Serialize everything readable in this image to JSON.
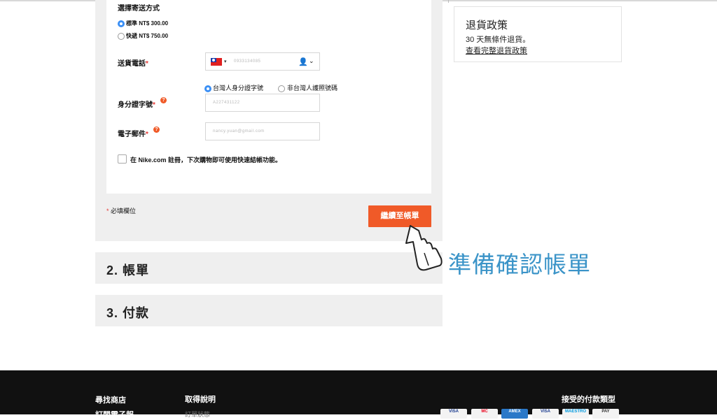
{
  "shipping": {
    "method_label": "選擇寄送方式",
    "options": [
      {
        "label": "標準 NT$ 300.00",
        "selected": true
      },
      {
        "label": "快遞 NT$ 750.00",
        "selected": false
      }
    ],
    "phone": {
      "label": "送貨電話",
      "required_mark": "*",
      "value": "0933134085"
    },
    "id_type": {
      "options": [
        {
          "label": "台灣人身分證字號",
          "selected": true
        },
        {
          "label": "非台灣人護照號碼",
          "selected": false
        }
      ]
    },
    "id_number": {
      "label": "身分證字號",
      "required_mark": "*",
      "value": "A227431122"
    },
    "email": {
      "label": "電子郵件",
      "required_mark": "*",
      "value": "nancy.yuan@gmail.com"
    },
    "register_checkbox_label": "在 Nike.com 註冊，下次購物即可使用快速結帳功能。",
    "required_note_star": "*",
    "required_note": "必填欄位",
    "continue_button": "繼續至帳單"
  },
  "sections": [
    {
      "label": "2. 帳單"
    },
    {
      "label": "3. 付款"
    }
  ],
  "return_policy": {
    "title": "退貨政策",
    "line": "30 天無條件退貨。",
    "link": "查看完整退貨政策"
  },
  "annotation": "準備確認帳單",
  "footer": {
    "col1": [
      "尋找商店",
      "訂閱電子報"
    ],
    "col2_title": "取得說明",
    "col2_item": "訂單狀態",
    "payments_title": "接受的付款類型",
    "cards": [
      {
        "name": "VISA",
        "bg": "#f3f3f3",
        "fg": "#1a3a8f"
      },
      {
        "name": "MC",
        "bg": "#f3f3f3",
        "fg": "#eb001b"
      },
      {
        "name": "AMEX",
        "bg": "#2a78c8",
        "fg": "#ffffff"
      },
      {
        "name": "VISA",
        "bg": "#f3f3f3",
        "fg": "#1a3a8f"
      },
      {
        "name": "MAESTRO",
        "bg": "#f3f3f3",
        "fg": "#0099df"
      },
      {
        "name": "PAY",
        "bg": "#f3f3f3",
        "fg": "#333333"
      }
    ]
  },
  "colors": {
    "accent": "#f05a28",
    "radio_selected": "#3b8ff5",
    "annotation": "#3b94c8",
    "footer_bg": "#111111"
  }
}
